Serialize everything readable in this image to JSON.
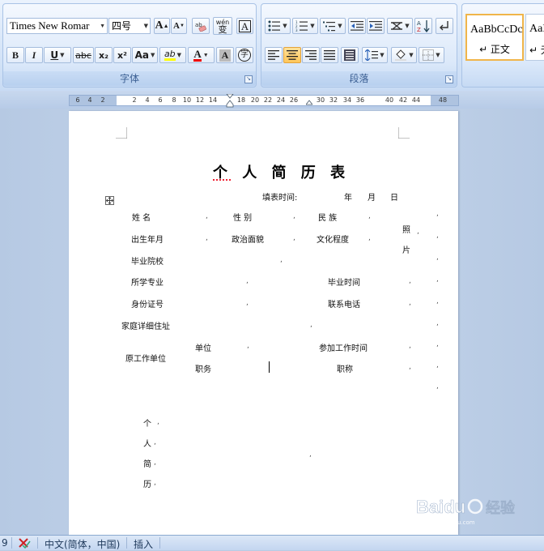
{
  "ribbon": {
    "font_group": {
      "title": "字体",
      "font_name": "Times New Romar",
      "font_size": "四号",
      "grow_label": "A",
      "shrink_label": "A",
      "phonetic_label": "wén",
      "phonetic_char": "变",
      "border_char": "A",
      "bold": "B",
      "italic": "I",
      "underline": "U",
      "strike": "abc",
      "subscript": "x₂",
      "superscript": "x²",
      "case": "Aa",
      "highlight": "ab",
      "font_color": "A",
      "shading": "A",
      "enclose": "字"
    },
    "paragraph_group": {
      "title": "段落"
    },
    "styles": {
      "sample1": "AaBbCcDc",
      "name1": "↵ 正文",
      "sample2": "AaB",
      "name2": "↵ 无"
    }
  },
  "ruler": {
    "numbers": [
      "6",
      "4",
      "2",
      "2",
      "4",
      "6",
      "8",
      "10",
      "12",
      "14",
      "18",
      "20",
      "22",
      "24",
      "26",
      "30",
      "32",
      "34",
      "36",
      "40",
      "42",
      "44",
      "48"
    ]
  },
  "document": {
    "title": "个 人 简 历 表",
    "fill_time": "填表时间:",
    "year": "年",
    "month": "月",
    "day": "日",
    "name": "姓      名",
    "gender": "性      别",
    "ethnicity": "民      族",
    "photo1": "照",
    "photo2": "片",
    "birth": "出生年月",
    "political": "政治面貌",
    "education": "文化程度",
    "school": "毕业院校",
    "major": "所学专业",
    "grad_time": "毕业时间",
    "id_no": "身份证号",
    "phone": "联系电话",
    "address": "家庭详细住址",
    "former_unit": "原工作单位",
    "unit": "单位",
    "start_work": "参加工作时间",
    "position": "职务",
    "title_rank": "职称",
    "resume1": "个",
    "resume2": "人",
    "resume3": "简",
    "resume4": "历"
  },
  "status": {
    "page": "9",
    "language": "中文(简体，中国)",
    "mode": "插入"
  },
  "watermark": {
    "brand": "Baidu",
    "text": "经验",
    "url": "jingyan.baidu.com"
  }
}
